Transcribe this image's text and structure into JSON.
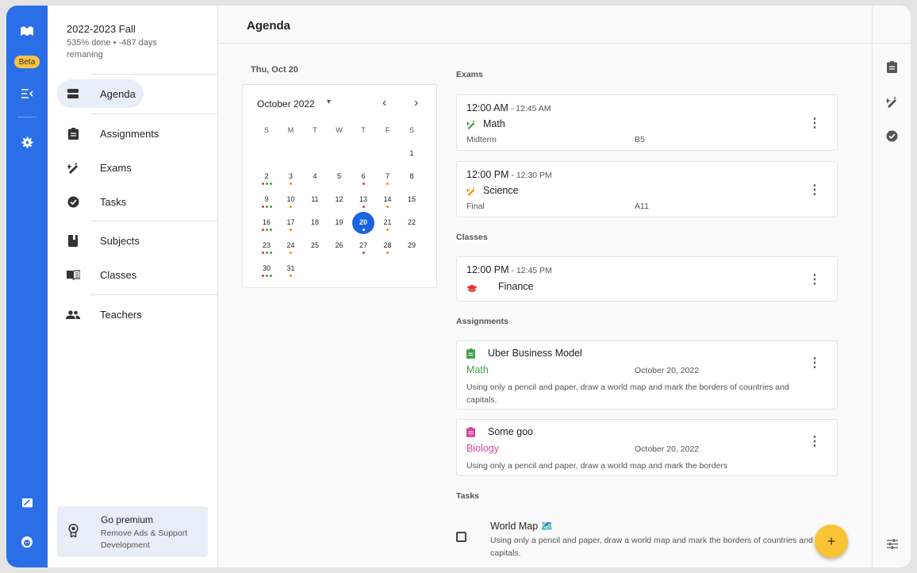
{
  "rail": {
    "beta": "Beta",
    "icons": [
      "logo-icon",
      "menu-collapse-icon",
      "settings-icon",
      "feedback-icon",
      "profile-icon"
    ]
  },
  "sidebar": {
    "term_title": "2022-2023 Fall",
    "term_sub": "535% done • -487 days remaning",
    "items": [
      {
        "label": "Agenda",
        "icon": "agenda-icon"
      },
      {
        "label": "Assignments",
        "icon": "assignment-icon"
      },
      {
        "label": "Exams",
        "icon": "exam-icon"
      },
      {
        "label": "Tasks",
        "icon": "task-icon"
      },
      {
        "label": "Subjects",
        "icon": "subject-icon"
      },
      {
        "label": "Classes",
        "icon": "class-icon"
      },
      {
        "label": "Teachers",
        "icon": "teachers-icon"
      }
    ],
    "premium_title": "Go premium",
    "premium_sub": "Remove Ads & Support Development"
  },
  "header": {
    "title": "Agenda"
  },
  "calendar": {
    "selected_date": "Thu, Oct 20",
    "month": "October 2022",
    "dow": [
      "S",
      "M",
      "T",
      "W",
      "T",
      "F",
      "S"
    ],
    "days": [
      "1",
      "2",
      "3",
      "4",
      "5",
      "6",
      "7",
      "8",
      "9",
      "10",
      "11",
      "12",
      "13",
      "14",
      "15",
      "16",
      "17",
      "18",
      "19",
      "20",
      "21",
      "22",
      "23",
      "24",
      "25",
      "26",
      "27",
      "28",
      "29",
      "30",
      "31"
    ],
    "today": "20",
    "colors": {
      "red": "#e53935",
      "green": "#43a047",
      "orange": "#fb8c00",
      "blue": "#1a64e2"
    }
  },
  "sections": {
    "exams": "Exams",
    "classes": "Classes",
    "assignments": "Assignments",
    "tasks": "Tasks"
  },
  "exams": [
    {
      "time": "12:00 AM",
      "end": " - 12:45 AM",
      "subject": "Math",
      "type": "Midterm",
      "room": "B5",
      "color": "#43a047"
    },
    {
      "time": "12:00 PM",
      "end": " - 12:30 PM",
      "subject": "Science",
      "type": "Final",
      "room": "A11",
      "color": "#fb8c00"
    }
  ],
  "classes": [
    {
      "time": "12:00 PM",
      "end": " - 12:45 PM",
      "subject": "Finance",
      "color": "#e53935"
    }
  ],
  "assignments": [
    {
      "title": "Uber Business Model",
      "subject": "Math",
      "date": "October 20, 2022",
      "desc": "Using only a pencil and paper, draw a world map and mark the borders of countries and capitals.",
      "color": "#43a047"
    },
    {
      "title": "Some goo",
      "subject": "Biology",
      "date": "October 20, 2022",
      "desc": "Using only a pencil and paper, draw a world map and mark the borders",
      "color": "#d6459a"
    }
  ],
  "tasks": [
    {
      "title": "World Map 🗺️",
      "desc": "Using only a pencil and paper, draw a world map and mark the borders of countries and capitals."
    }
  ],
  "fab": "+",
  "more": "⋮",
  "nav_prev": "‹",
  "nav_next": "›",
  "dropdown": "▾"
}
